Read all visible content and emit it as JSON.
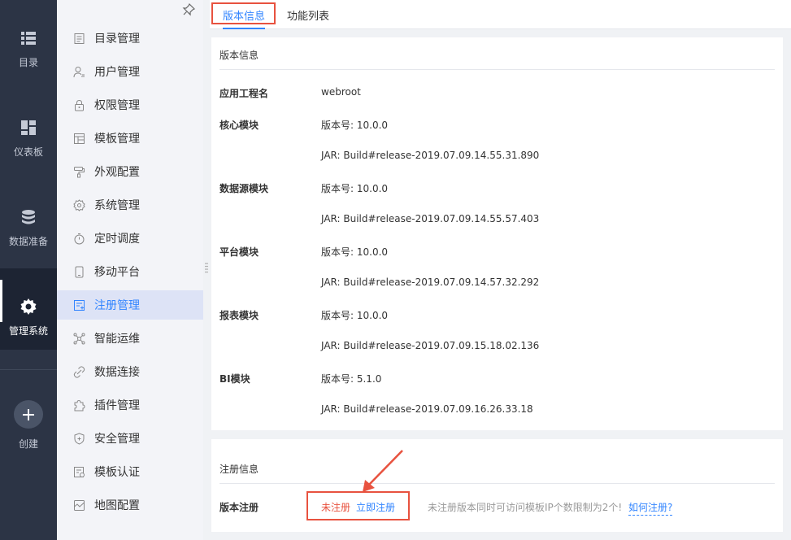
{
  "rail": {
    "items": [
      {
        "label": "目录",
        "icon": "list-icon"
      },
      {
        "label": "仪表板",
        "icon": "dashboard-icon"
      },
      {
        "label": "数据准备",
        "icon": "database-icon"
      },
      {
        "label": "管理系统",
        "icon": "gear-icon",
        "active": true
      },
      {
        "label": "创建",
        "icon": "plus-icon"
      }
    ]
  },
  "submenu": {
    "items": [
      {
        "label": "目录管理",
        "icon": "directory-icon"
      },
      {
        "label": "用户管理",
        "icon": "user-icon"
      },
      {
        "label": "权限管理",
        "icon": "lock-icon"
      },
      {
        "label": "模板管理",
        "icon": "template-icon"
      },
      {
        "label": "外观配置",
        "icon": "paint-roller-icon"
      },
      {
        "label": "系统管理",
        "icon": "settings-icon"
      },
      {
        "label": "定时调度",
        "icon": "timer-icon"
      },
      {
        "label": "移动平台",
        "icon": "mobile-icon"
      },
      {
        "label": "注册管理",
        "icon": "register-icon",
        "active": true
      },
      {
        "label": "智能运维",
        "icon": "network-icon"
      },
      {
        "label": "数据连接",
        "icon": "link-icon"
      },
      {
        "label": "插件管理",
        "icon": "puzzle-icon"
      },
      {
        "label": "安全管理",
        "icon": "shield-icon"
      },
      {
        "label": "模板认证",
        "icon": "certificate-icon"
      },
      {
        "label": "地图配置",
        "icon": "map-icon"
      }
    ]
  },
  "tabs": [
    {
      "label": "版本信息",
      "active": true
    },
    {
      "label": "功能列表",
      "active": false
    }
  ],
  "version_panel": {
    "title": "版本信息",
    "app_name_label": "应用工程名",
    "app_name_value": "webroot",
    "modules": [
      {
        "label": "核心模块",
        "version": "版本号: 10.0.0",
        "jar": "JAR: Build#release-2019.07.09.14.55.31.890"
      },
      {
        "label": "数据源模块",
        "version": "版本号: 10.0.0",
        "jar": "JAR: Build#release-2019.07.09.14.55.57.403"
      },
      {
        "label": "平台模块",
        "version": "版本号: 10.0.0",
        "jar": "JAR: Build#release-2019.07.09.14.57.32.292"
      },
      {
        "label": "报表模块",
        "version": "版本号: 10.0.0",
        "jar": "JAR: Build#release-2019.07.09.15.18.02.136"
      },
      {
        "label": "BI模块",
        "version": "版本号: 5.1.0",
        "jar": "JAR: Build#release-2019.07.09.16.26.33.18"
      }
    ]
  },
  "register_panel": {
    "title": "注册信息",
    "row_label": "版本注册",
    "status": "未注册",
    "register_link": "立即注册",
    "note": "未注册版本同时可访问模板IP个数限制为2个!",
    "how_link": "如何注册?"
  },
  "colors": {
    "accent": "#3285ff",
    "highlight_red": "#e8523f",
    "rail_bg": "#2c3445"
  }
}
